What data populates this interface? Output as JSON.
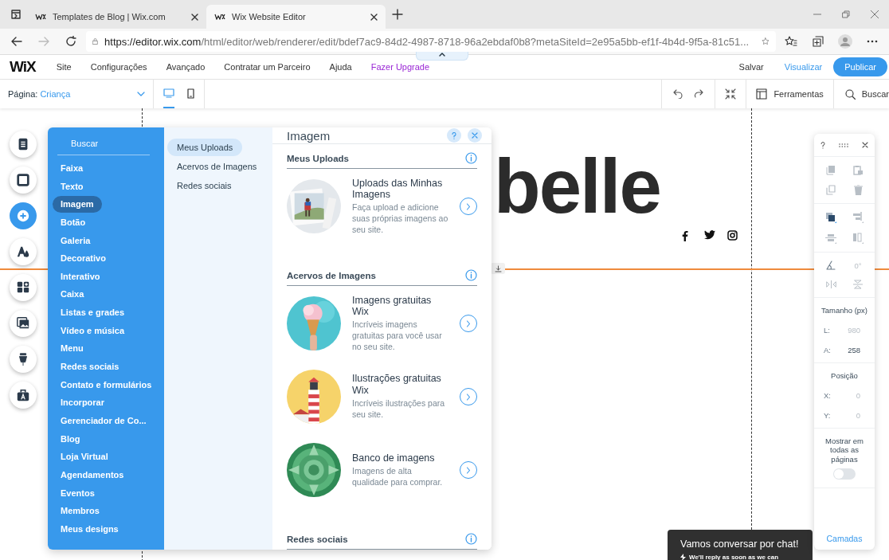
{
  "browser": {
    "tabs": [
      {
        "title": "Templates de Blog | Wix.com",
        "selected": false
      },
      {
        "title": "Wix Website Editor",
        "selected": true
      }
    ],
    "url_host": "https://editor.wix.com",
    "url_path": "/html/editor/web/renderer/edit/bdef7ac9-84d2-4987-8718-96a2ebdaf0b8?metaSiteId=2e95a5bb-ef1f-4b4d-9f5a-81c51..."
  },
  "menu": {
    "logo": "WiX",
    "items": [
      {
        "label": "Site",
        "kind": "plain"
      },
      {
        "label": "Configurações",
        "kind": "plain"
      },
      {
        "label": "Avançado",
        "kind": "plain"
      },
      {
        "label": "Contratar um Parceiro",
        "kind": "plain"
      },
      {
        "label": "Ajuda",
        "kind": "plain"
      },
      {
        "label": "Fazer Upgrade",
        "kind": "upgrade"
      }
    ],
    "save": "Salvar",
    "preview": "Visualizar",
    "publish": "Publicar"
  },
  "toolbar": {
    "page_label": "Página:",
    "page_value": "Criança",
    "devices": [
      {
        "kind": "desktop",
        "selected": true
      },
      {
        "kind": "mobile",
        "selected": false
      }
    ],
    "tools": "Ferramentas",
    "search": "Buscar"
  },
  "rail": [
    {
      "kind": "pages",
      "selected": false
    },
    {
      "kind": "background",
      "selected": false
    },
    {
      "kind": "add",
      "selected": true
    },
    {
      "kind": "theme",
      "selected": false
    },
    {
      "kind": "apps",
      "selected": false
    },
    {
      "kind": "media",
      "selected": false
    },
    {
      "kind": "blog",
      "selected": false
    },
    {
      "kind": "market",
      "selected": false
    }
  ],
  "add_panel": {
    "search_placeholder": "Buscar",
    "categories": [
      {
        "label": "Faixa",
        "selected": false
      },
      {
        "label": "Texto",
        "selected": false
      },
      {
        "label": "Imagem",
        "selected": true
      },
      {
        "label": "Botão",
        "selected": false
      },
      {
        "label": "Galeria",
        "selected": false
      },
      {
        "label": "Decorativo",
        "selected": false
      },
      {
        "label": "Interativo",
        "selected": false
      },
      {
        "label": "Caixa",
        "selected": false
      },
      {
        "label": "Listas e grades",
        "selected": false
      },
      {
        "label": "Vídeo e música",
        "selected": false
      },
      {
        "label": "Menu",
        "selected": false
      },
      {
        "label": "Redes sociais",
        "selected": false
      },
      {
        "label": "Contato e formulários",
        "selected": false
      },
      {
        "label": "Incorporar",
        "selected": false
      },
      {
        "label": "Gerenciador de Co...",
        "selected": false
      },
      {
        "label": "Blog",
        "selected": false
      },
      {
        "label": "Loja Virtual",
        "selected": false
      },
      {
        "label": "Agendamentos",
        "selected": false
      },
      {
        "label": "Eventos",
        "selected": false
      },
      {
        "label": "Membros",
        "selected": false
      },
      {
        "label": "Meus designs",
        "selected": false
      }
    ],
    "subcategories": [
      {
        "label": "Meus Uploads",
        "selected": true
      },
      {
        "label": "Acervos de Imagens",
        "selected": false
      },
      {
        "label": "Redes sociais",
        "selected": false
      }
    ],
    "title": "Imagem",
    "sections": [
      {
        "title": "Meus Uploads",
        "items": [
          {
            "title": "Uploads das Minhas Imagens",
            "description": "Faça upload e adicione suas próprias imagens ao seu site.",
            "kind": "hiker"
          }
        ]
      },
      {
        "title": "Acervos de Imagens",
        "items": [
          {
            "title": "Imagens gratuitas Wix",
            "description": "Incríveis imagens gratuitas para você usar no seu site.",
            "kind": "icecream"
          },
          {
            "title": "Ilustrações gratuitas Wix",
            "description": "Incríveis ilustrações para seu site.",
            "kind": "lighthouse"
          },
          {
            "title": "Banco de imagens",
            "description": "Imagens de alta qualidade para comprar.",
            "kind": "succulent"
          }
        ]
      },
      {
        "title": "Redes sociais"
      }
    ]
  },
  "canvas": {
    "heading": "belle"
  },
  "inspector": {
    "rotation": "0°",
    "size_title": "Tamanho (px)",
    "size_fields": [
      {
        "label": "L:",
        "value": "980",
        "disabled": true
      },
      {
        "label": "A:",
        "value": "258",
        "disabled": false
      }
    ],
    "position_title": "Posição",
    "position_fields": [
      {
        "label": "X:",
        "value": "0",
        "disabled": true
      },
      {
        "label": "Y:",
        "value": "0",
        "disabled": true
      }
    ],
    "show_all_label": "Mostrar em todas as páginas",
    "show_all_on": false,
    "layers": "Camadas"
  },
  "chat": {
    "title": "Vamos conversar por chat!",
    "subtitle": "We'll reply as soon as we can"
  }
}
